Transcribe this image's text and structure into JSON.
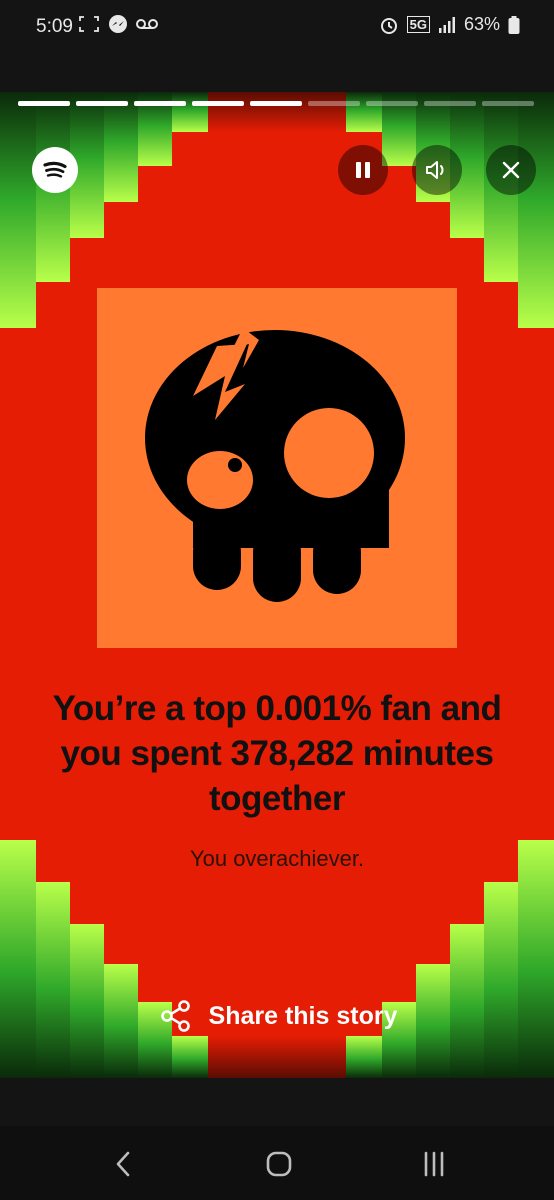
{
  "status_bar": {
    "time": "5:09",
    "network": "5G",
    "battery": "63%"
  },
  "story": {
    "progress_total": 9,
    "progress_done": 5,
    "headline_line1": "You’re a top 0.001% fan and",
    "headline_line2": "you spent 378,282 minutes",
    "headline_line3": "together",
    "subtitle": "You overachiever.",
    "share_label": "Share this story"
  },
  "colors": {
    "background_red": "#e51d05",
    "art_orange": "#ff7a30",
    "bar_green": "#7bff3c"
  }
}
